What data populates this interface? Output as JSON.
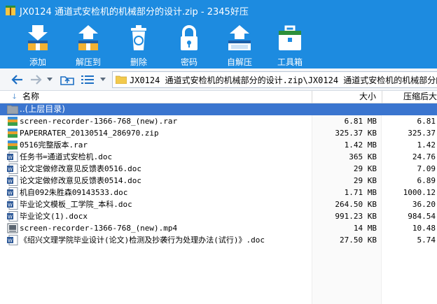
{
  "window": {
    "title": "JX0124 通道式安检机的机械部分的设计.zip - 2345好压"
  },
  "toolbar": {
    "items": [
      {
        "label": "添加",
        "icon": "add-archive-icon"
      },
      {
        "label": "解压到",
        "icon": "extract-to-icon"
      },
      {
        "label": "删除",
        "icon": "delete-icon"
      },
      {
        "label": "密码",
        "icon": "lock-icon"
      },
      {
        "label": "自解压",
        "icon": "self-extract-icon"
      },
      {
        "label": "工具箱",
        "icon": "toolbox-icon"
      }
    ]
  },
  "navigation": {
    "path": "JX0124 通道式安检机的机械部分的设计.zip\\JX0124 通道式安检机的机械部分的设"
  },
  "columns": {
    "name": "名称",
    "size": "大小",
    "compressed": "压缩后大"
  },
  "files": [
    {
      "name": "..(上层目录)",
      "size": "",
      "compressed": "",
      "type": "parent"
    },
    {
      "name": "screen-recorder-1366-768_(new).rar",
      "size": "6.81 MB",
      "compressed": "6.81",
      "type": "rar"
    },
    {
      "name": "PAPERRATER_20130514_286970.zip",
      "size": "325.37 KB",
      "compressed": "325.37",
      "type": "rar"
    },
    {
      "name": "0516完整版本.rar",
      "size": "1.42 MB",
      "compressed": "1.42",
      "type": "rar"
    },
    {
      "name": "任务书=通道式安检机.doc",
      "size": "365 KB",
      "compressed": "24.76",
      "type": "doc"
    },
    {
      "name": "论文定做修改意见反馈表0516.doc",
      "size": "29 KB",
      "compressed": "7.09",
      "type": "doc"
    },
    {
      "name": "论文定做修改意见反馈表0514.doc",
      "size": "29 KB",
      "compressed": "6.89",
      "type": "doc"
    },
    {
      "name": "机自092朱胜森09143533.doc",
      "size": "1.71 MB",
      "compressed": "1000.12",
      "type": "doc"
    },
    {
      "name": "毕业论文模板_工学院_本科.doc",
      "size": "264.50 KB",
      "compressed": "36.20",
      "type": "doc"
    },
    {
      "name": "毕业论文(1).docx",
      "size": "991.23 KB",
      "compressed": "984.54",
      "type": "doc"
    },
    {
      "name": "screen-recorder-1366-768_(new).mp4",
      "size": "14 MB",
      "compressed": "10.48",
      "type": "video"
    },
    {
      "name": "《绍兴文理学院毕业设计(论文)检测及抄袭行为处理办法(试行)》.doc",
      "size": "27.50 KB",
      "compressed": "5.74",
      "type": "doc"
    }
  ],
  "colors": {
    "titlebar": "#1d8be0",
    "selection": "#3a75cf"
  }
}
